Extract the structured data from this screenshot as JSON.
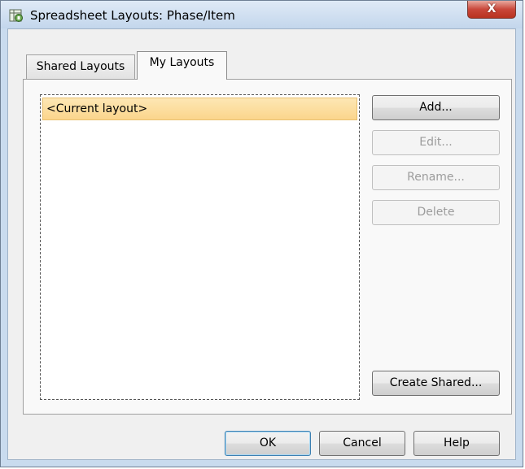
{
  "window": {
    "title": "Spreadsheet Layouts: Phase/Item",
    "close_label": "X"
  },
  "tabs": [
    {
      "label": "Shared Layouts",
      "selected": false
    },
    {
      "label": "My Layouts",
      "selected": true
    }
  ],
  "list": {
    "items": [
      "<Current layout>"
    ],
    "selected_index": 0
  },
  "side_buttons": {
    "add": "Add...",
    "edit": "Edit...",
    "rename": "Rename...",
    "delete": "Delete",
    "create_shared": "Create Shared..."
  },
  "footer": {
    "ok": "OK",
    "cancel": "Cancel",
    "help": "Help"
  },
  "colors": {
    "selection": "#fbd58c",
    "close": "#c9473a",
    "titlebar": "#c9dbee"
  }
}
